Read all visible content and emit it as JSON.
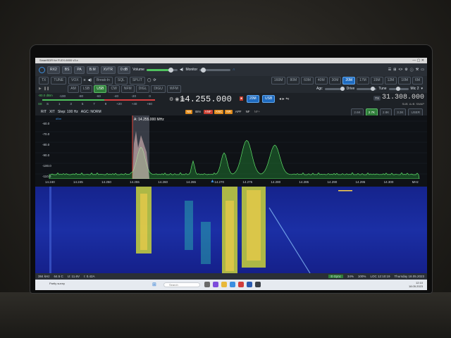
{
  "title": "SmartSDR for FLEX-6000 v3.x",
  "toolbar": {
    "buttons": [
      "RX2",
      "BS",
      "PA",
      "B.M",
      "XVTR",
      "0 dB"
    ],
    "volume_label": "Volume",
    "monitor_label": "Monitor"
  },
  "row2": {
    "tx": "TX",
    "tune": "TUNE",
    "vox": "VOX",
    "breakin": "Break-In",
    "sql": "SQL",
    "split": "SPLIT"
  },
  "bands": [
    "160M",
    "80M",
    "60M",
    "40M",
    "30M",
    "20M",
    "17M",
    "15M",
    "12M",
    "10M",
    "6M"
  ],
  "active_band": "20M",
  "row3": {
    "modes": [
      "AM",
      "LSB",
      "USB",
      "CW",
      "NFM",
      "DIGL",
      "DIGU",
      "WFM"
    ],
    "active_mode": "USB",
    "agc_label": "Agc",
    "drive_label": "Drive",
    "tune_label": "Tune",
    "mic_label": "Mic 2"
  },
  "smeter": {
    "dbm": "-80.0 dBm",
    "scale": [
      "-100",
      "-80",
      "-60",
      "-40",
      "-20",
      "0"
    ],
    "sunits": [
      "S",
      "1",
      "3",
      "5",
      "7",
      "9",
      "+20",
      "+40",
      "+60"
    ],
    "level": "S8"
  },
  "vfo_a": {
    "frequency": "14.255.000",
    "band": "20M",
    "mode": "USB"
  },
  "vfo_b": {
    "frequency": "31.308.000",
    "tx": "TX",
    "sub": "SUB",
    "a_b": "A>B",
    "swap": "SWAP"
  },
  "row5": {
    "rit": "RIT",
    "xit": "XIT",
    "step": "Step: 100 Hz",
    "agc": "AGC: NORM"
  },
  "dsp": [
    "NB",
    "BIN",
    "ANF",
    "ANC",
    "NR",
    "APF",
    "NF",
    "NF+"
  ],
  "filters": [
    "2.6K",
    "2.7K",
    "2.8K",
    "3.3K",
    "USER"
  ],
  "active_filter": "2.7K",
  "spectrum": {
    "y_ticks": [
      "-60.0",
      "-70.0",
      "-80.0",
      "-90.0",
      "-100.0",
      "-110.0"
    ],
    "marker": "A: 14.255.000 MHz",
    "x_ticks": [
      "14.240",
      "14.245",
      "14.250",
      "14.255",
      "14.260",
      "14.265",
      "14.270",
      "14.275",
      "14.280",
      "14.285",
      "14.290",
      "14.295",
      "14.300",
      "MHz"
    ]
  },
  "status": {
    "items": [
      "384 kHz",
      "64.5 C",
      "U: 11.6V",
      "I: 0.42A"
    ],
    "sync": "E-Sync",
    "pct": "34%",
    "percent2": "100%",
    "time": "LOC 12:10:19",
    "date": "Thursday 18.05.2023"
  },
  "taskbar": {
    "search": "Search",
    "weather": "Partly sunny",
    "time": "12:10",
    "date": "18.05.2023"
  }
}
